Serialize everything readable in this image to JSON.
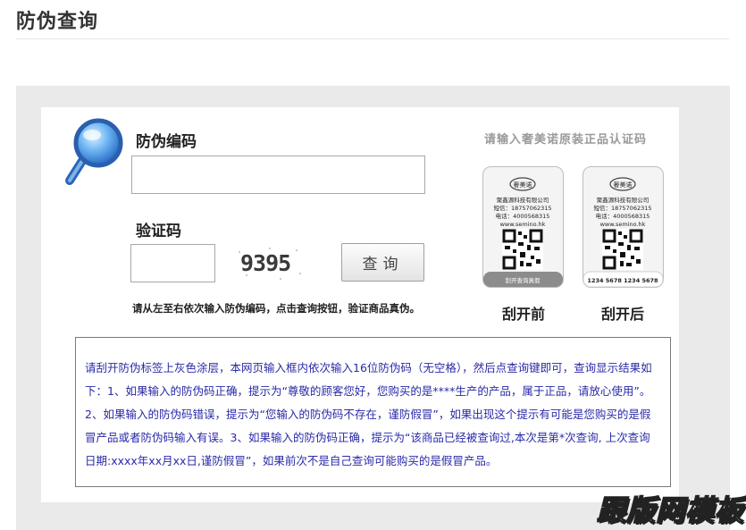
{
  "page": {
    "title": "防伪查询"
  },
  "form": {
    "code_label": "防伪编码",
    "code_value": "",
    "verify_label": "验证码",
    "verify_value": "",
    "captcha_text": "9395",
    "query_button": "查询",
    "hint": "请从左至右依次输入防伪编码，点击查询按钮，验证商品真伪。"
  },
  "sample": {
    "heading": "请输入奢美诺原装正品认证码",
    "before_caption": "刮开前",
    "after_caption": "刮开后",
    "company": "聚鑫源科技有限公司",
    "sms": "短信：18757062315",
    "phone": "电话：4000568315",
    "site": "www.semino.hk",
    "before_strip": "刮开查询真假",
    "after_strip": "1234 5678 1234 5678"
  },
  "instructions": {
    "text": "请刮开防伪标签上灰色涂层，本网页输入框内依次输入16位防伪码（无空格），然后点查询键即可，查询显示结果如下：1、如果输入的防伪码正确，提示为“尊敬的顾客您好，您购买的是****生产的产品，属于正品，请放心使用”。2、如果输入的防伪码错误，提示为“您输入的防伪码不存在，谨防假冒”，如果出现这个提示有可能是您购买的是假冒产品或者防伪码输入有误。3、如果输入的防伪码正确，提示为“该商品已经被查询过,本次是第*次查询, 上次查询日期:xxxx年xx月xx日,谨防假冒”，如果前次不是自己查询可能购买的是假冒产品。"
  },
  "watermark": {
    "text": "跟版网模板"
  },
  "colors": {
    "instruction_text": "#2a2aa8",
    "panel_bg": "#eaeaea",
    "hint_gray": "#9a9a9a"
  }
}
